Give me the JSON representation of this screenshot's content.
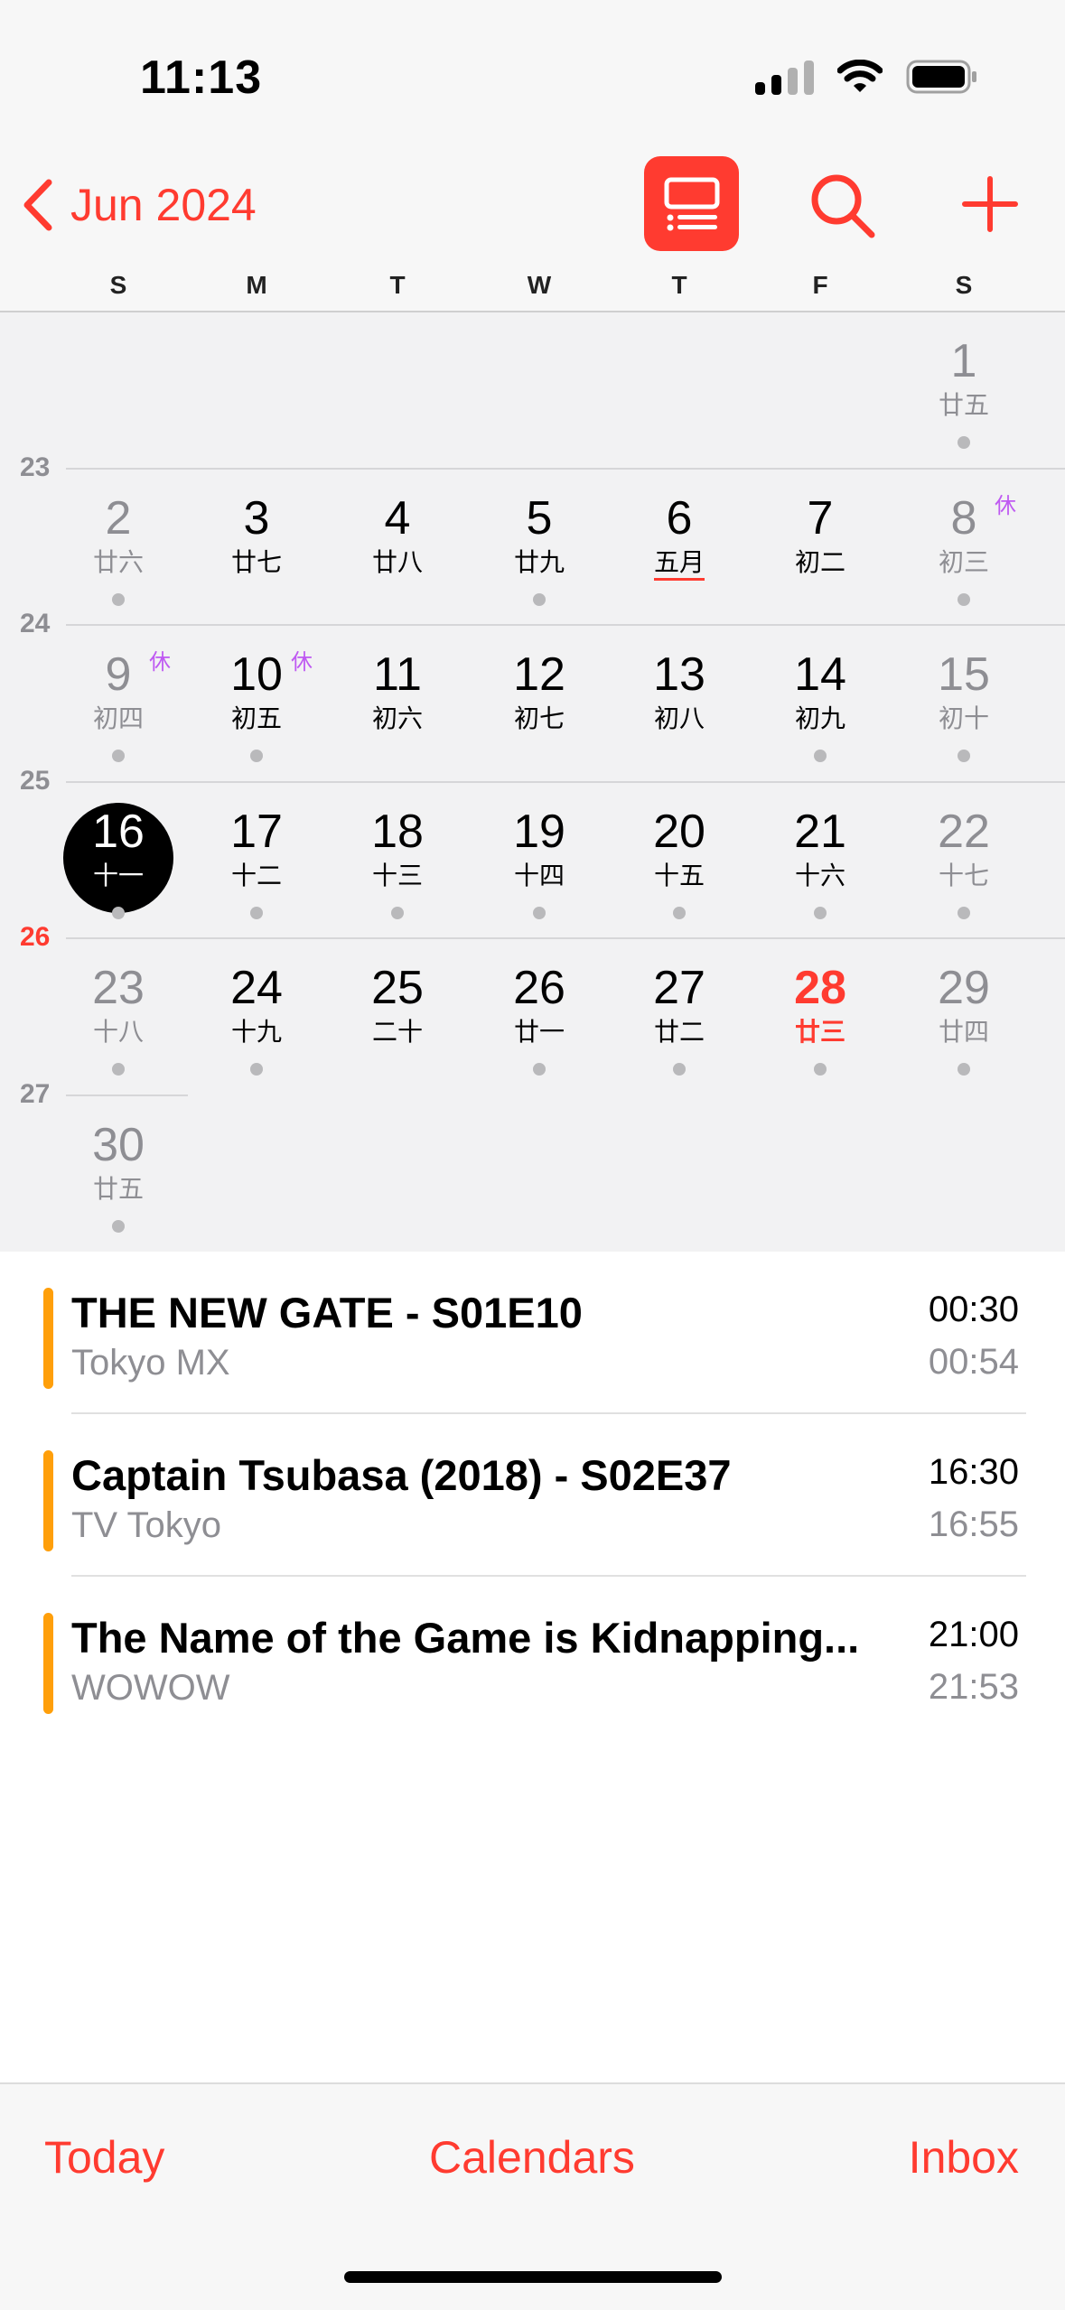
{
  "status_bar": {
    "time": "11:13",
    "icons": [
      "cellular-signal-icon",
      "wifi-icon",
      "battery-icon"
    ]
  },
  "header": {
    "back_label": "Jun 2024",
    "buttons": [
      "list-view-icon",
      "search-icon",
      "add-icon"
    ],
    "accent_color": "#ff3b30"
  },
  "weekdays": [
    "S",
    "M",
    "T",
    "W",
    "T",
    "F",
    "S"
  ],
  "calendar": {
    "week_numbers": [
      "23",
      "24",
      "25",
      "26",
      "27"
    ],
    "current_week": "26",
    "weeks": [
      [
        null,
        null,
        null,
        null,
        null,
        null,
        {
          "num": "1",
          "lunar": "廿五",
          "dot": true
        }
      ],
      [
        {
          "num": "2",
          "lunar": "廿六",
          "dot": true
        },
        {
          "num": "3",
          "lunar": "廿七",
          "dot": false
        },
        {
          "num": "4",
          "lunar": "廿八",
          "dot": false
        },
        {
          "num": "5",
          "lunar": "廿九",
          "dot": true
        },
        {
          "num": "6",
          "lunar": "五月",
          "dot": false,
          "month_start": true
        },
        {
          "num": "7",
          "lunar": "初二",
          "dot": false
        },
        {
          "num": "8",
          "lunar": "初三",
          "dot": true,
          "holiday": "休"
        }
      ],
      [
        {
          "num": "9",
          "lunar": "初四",
          "dot": true,
          "holiday": "休"
        },
        {
          "num": "10",
          "lunar": "初五",
          "dot": true,
          "holiday": "休"
        },
        {
          "num": "11",
          "lunar": "初六",
          "dot": false
        },
        {
          "num": "12",
          "lunar": "初七",
          "dot": false
        },
        {
          "num": "13",
          "lunar": "初八",
          "dot": false
        },
        {
          "num": "14",
          "lunar": "初九",
          "dot": true
        },
        {
          "num": "15",
          "lunar": "初十",
          "dot": true
        }
      ],
      [
        {
          "num": "16",
          "lunar": "十一",
          "dot": true,
          "selected": true
        },
        {
          "num": "17",
          "lunar": "十二",
          "dot": true
        },
        {
          "num": "18",
          "lunar": "十三",
          "dot": true
        },
        {
          "num": "19",
          "lunar": "十四",
          "dot": true
        },
        {
          "num": "20",
          "lunar": "十五",
          "dot": true
        },
        {
          "num": "21",
          "lunar": "十六",
          "dot": true
        },
        {
          "num": "22",
          "lunar": "十七",
          "dot": true
        }
      ],
      [
        {
          "num": "23",
          "lunar": "十八",
          "dot": true
        },
        {
          "num": "24",
          "lunar": "十九",
          "dot": true
        },
        {
          "num": "25",
          "lunar": "二十",
          "dot": false
        },
        {
          "num": "26",
          "lunar": "廿一",
          "dot": true
        },
        {
          "num": "27",
          "lunar": "廿二",
          "dot": true
        },
        {
          "num": "28",
          "lunar": "廿三",
          "dot": true,
          "today": true
        },
        {
          "num": "29",
          "lunar": "廿四",
          "dot": true
        }
      ],
      [
        {
          "num": "30",
          "lunar": "廿五",
          "dot": true
        },
        null,
        null,
        null,
        null,
        null,
        null
      ]
    ]
  },
  "events": [
    {
      "title": "THE NEW GATE - S01E10",
      "subtitle": "Tokyo MX",
      "start": "00:30",
      "end": "00:54",
      "color": "#ff9f0a"
    },
    {
      "title": "Captain Tsubasa (2018) - S02E37",
      "subtitle": "TV Tokyo",
      "start": "16:30",
      "end": "16:55",
      "color": "#ff9f0a"
    },
    {
      "title": "The Name of the Game is Kidnapping...",
      "subtitle": "WOWOW",
      "start": "21:00",
      "end": "21:53",
      "color": "#ff9f0a"
    }
  ],
  "tabbar": {
    "today": "Today",
    "calendars": "Calendars",
    "inbox": "Inbox"
  }
}
